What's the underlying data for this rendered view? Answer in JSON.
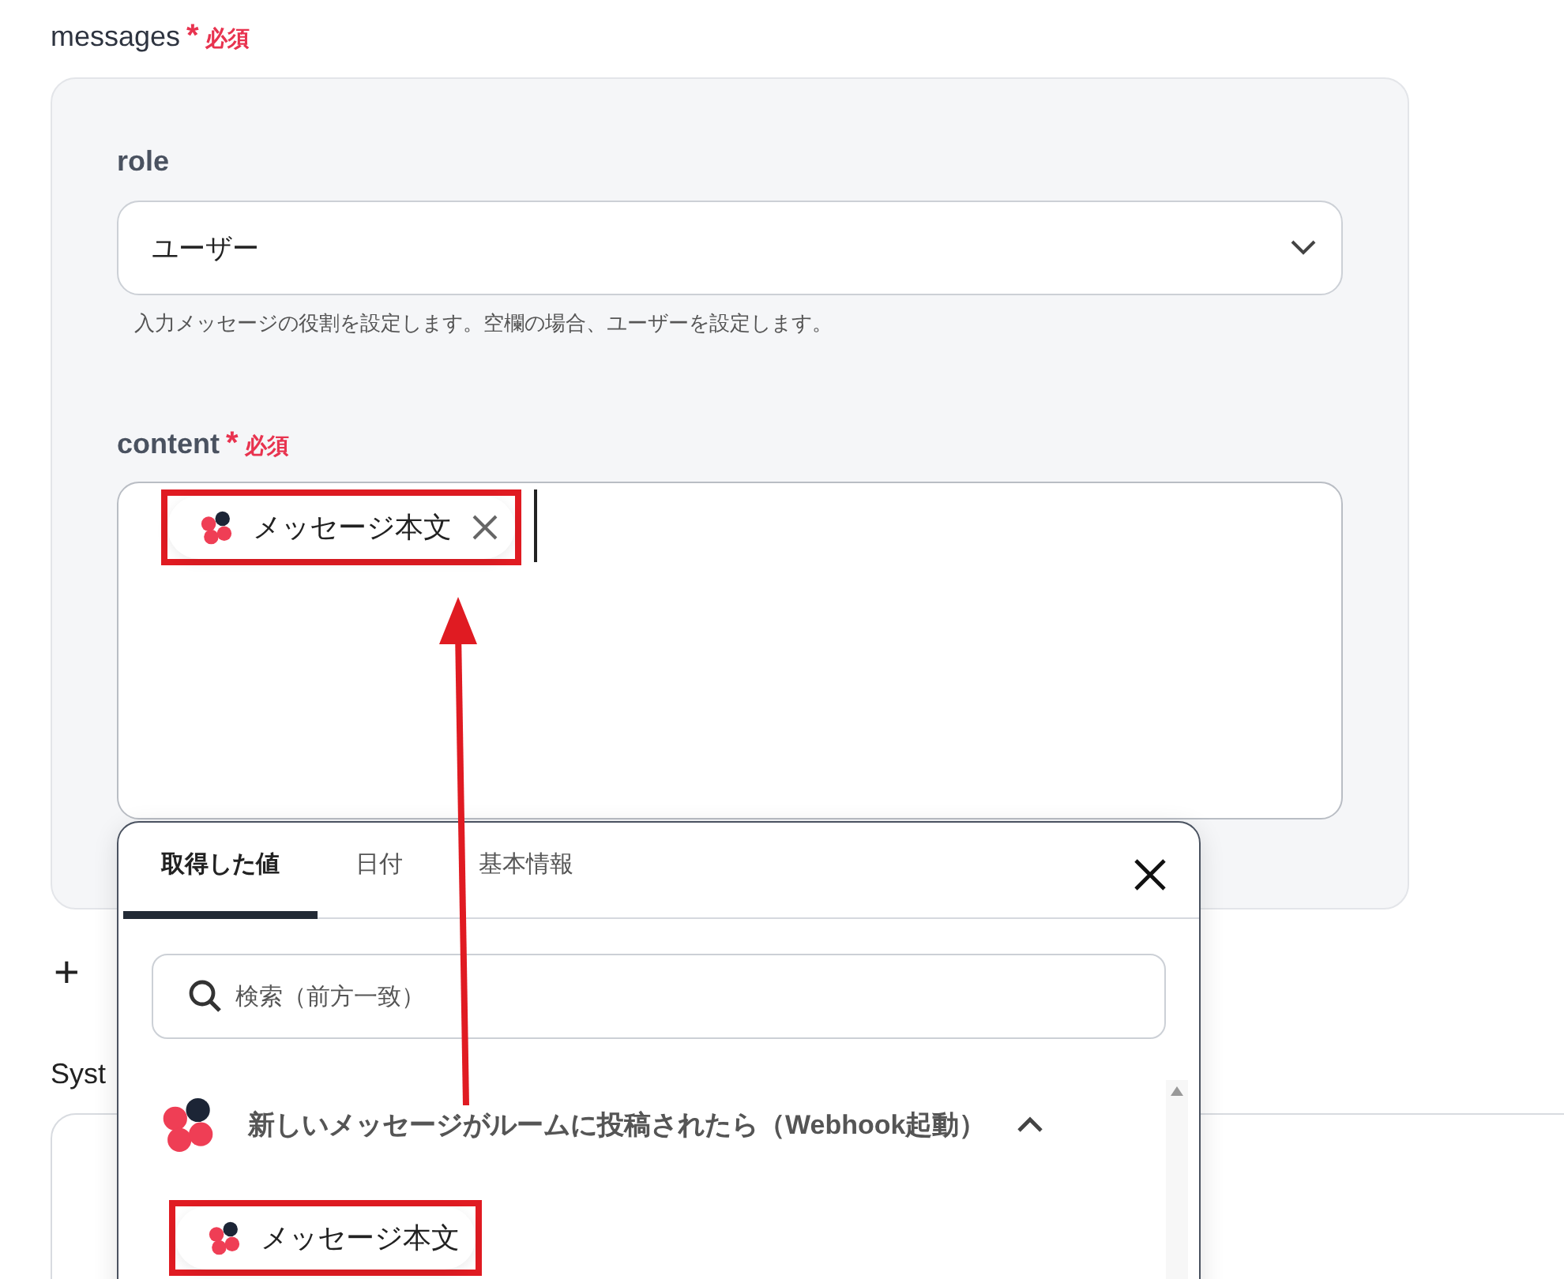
{
  "messages": {
    "label": "messages",
    "required_mark": "*",
    "required_text": "必須"
  },
  "role": {
    "label": "role",
    "value": "ユーザー",
    "hint": "入力メッセージの役割を設定します。空欄の場合、ユーザーを設定します。"
  },
  "content": {
    "label": "content",
    "required_mark": "*",
    "required_text": "必須",
    "tokens": [
      {
        "label": "メッセージ本文",
        "highlighted": true
      }
    ]
  },
  "add_button": "+",
  "next_field": {
    "label": "Syst"
  },
  "picker": {
    "tabs": [
      {
        "label": "取得した値",
        "selected": true
      },
      {
        "label": "日付",
        "selected": false
      },
      {
        "label": "基本情報",
        "selected": false
      }
    ],
    "search": {
      "placeholder": "検索（前方一致）"
    },
    "groups": [
      {
        "title": "新しいメッセージがルームに投稿されたら（Webhook起動）",
        "expanded": true,
        "items": [
          {
            "label": "メッセージ本文",
            "highlighted": true
          }
        ]
      }
    ]
  }
}
